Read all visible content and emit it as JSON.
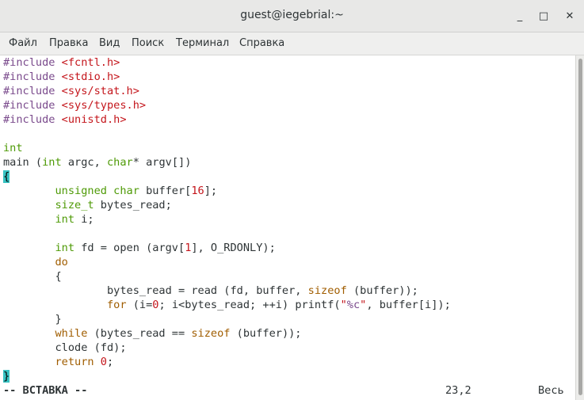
{
  "window": {
    "title": "guest@iegebrial:~",
    "minimize_glyph": "_",
    "maximize_glyph": "□",
    "close_glyph": "✕"
  },
  "menu": [
    "Файл",
    "Правка",
    "Вид",
    "Поиск",
    "Терминал",
    "Справка"
  ],
  "code": {
    "inc": "#include",
    "h1": "<fcntl.h>",
    "h2": "<stdio.h>",
    "h3": "<sys/stat.h>",
    "h4": "<sys/types.h>",
    "h5": "<unistd.h>",
    "ret_type": "int",
    "main_pre": "main (",
    "int_kw": "int",
    "argc_part": " argc, ",
    "char_kw": "char",
    "argv_part": "* argv[])",
    "open_brace": "{",
    "indent1": "        ",
    "indent2": "                ",
    "unsigned_char": "unsigned char",
    "buffer_decl": " buffer[",
    "sixteen": "16",
    "bracket_semi": "];",
    "size_t": "size_t",
    "bytes_read_decl": " bytes_read;",
    "i_decl_kw": "int",
    "i_decl": " i;",
    "fd_kw": "int",
    "fd_pre": " fd = open (argv[",
    "one": "1",
    "fd_post": "], O_RDONLY);",
    "do_kw": "do",
    "inner_open": "{",
    "read_pre": "bytes_read = read (fd, buffer, ",
    "sizeof_kw": "sizeof",
    "read_post": " (buffer));",
    "for_kw": "for",
    "for_pre": " (i=",
    "zero": "0",
    "for_mid": "; i<bytes_read; ++i) printf(",
    "quote_open": "\"",
    "fmt": "%c",
    "quote_close": "\"",
    "for_post": ", buffer[i]);",
    "inner_close": "}",
    "while_kw": "while",
    "while_pre": " (bytes_read == ",
    "sizeof_kw2": "sizeof",
    "while_post": " (buffer));",
    "clode": "clode (fd);",
    "return_kw": "return",
    "space": " ",
    "ret_zero": "0",
    "semi": ";",
    "close_brace": "}"
  },
  "status": {
    "mode": "-- ВСТАВКА --",
    "position": "23,2",
    "scroll": "Весь"
  }
}
